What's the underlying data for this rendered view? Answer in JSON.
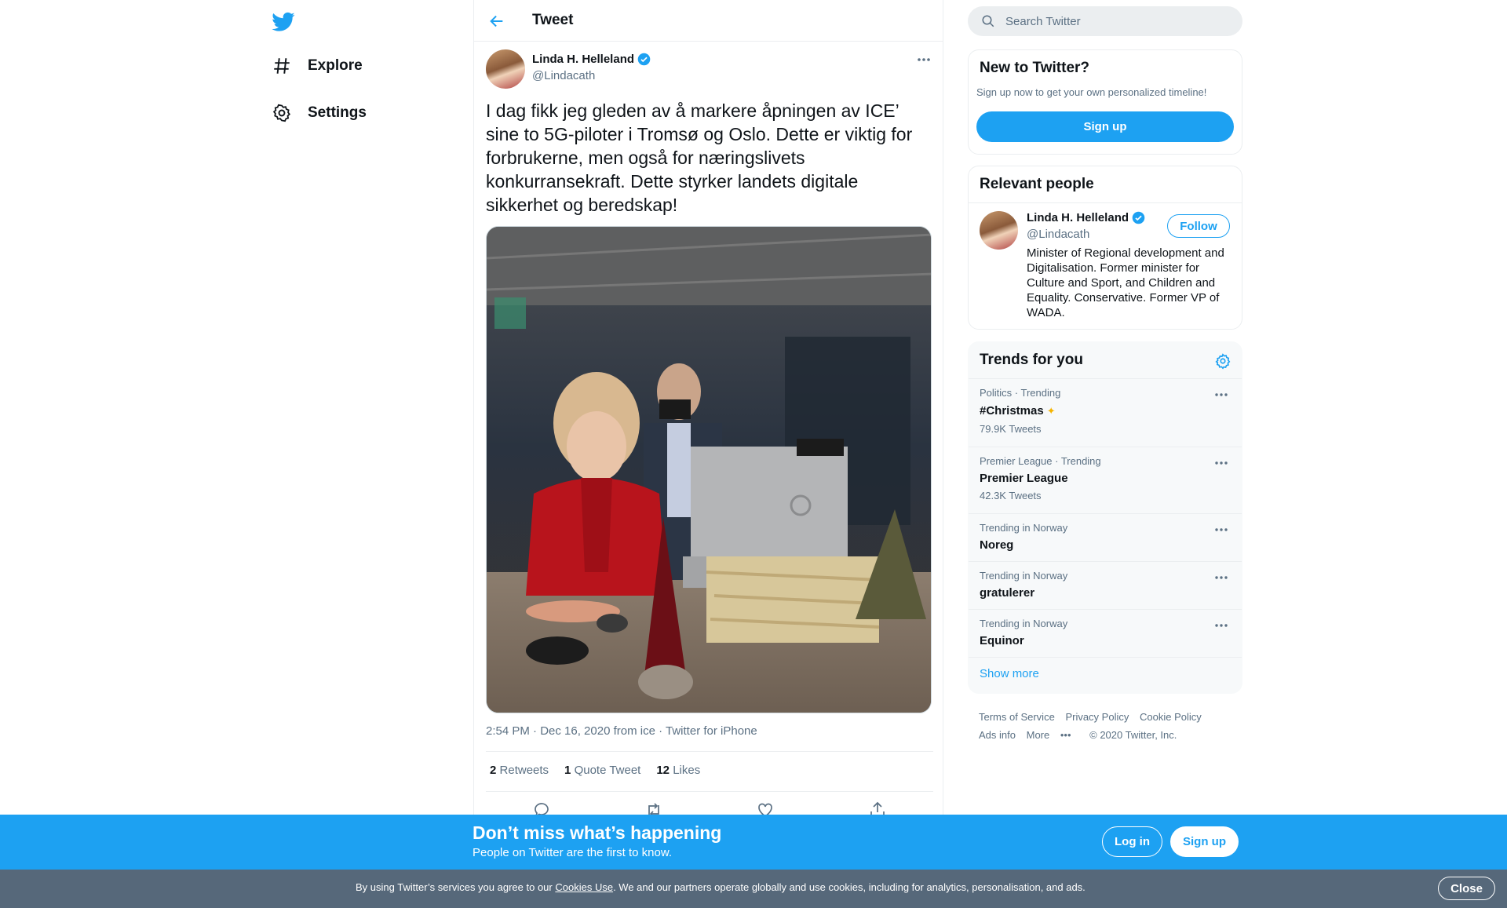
{
  "nav": {
    "logo_icon": "twitter-bird-icon",
    "items": [
      {
        "label": "Explore",
        "icon": "hashtag-icon"
      },
      {
        "label": "Settings",
        "icon": "gear-icon"
      }
    ]
  },
  "header": {
    "title": "Tweet",
    "back_icon": "arrow-left-icon"
  },
  "tweet": {
    "author_name": "Linda H. Helleland",
    "author_handle": "@Lindacath",
    "verified": true,
    "text": "I dag fikk jeg gleden av å markere åpningen av ICE’ sine to 5G-piloter i Tromsø og Oslo. Dette er viktig for forbrukerne, men også for næringslivets konkurransekraft. Dette styrker landets digitale sikkerhet og beredskap!",
    "time": "2:54 PM · Dec 16, 2020 from ice",
    "source": "Twitter for iPhone",
    "retweets_count": "2",
    "retweets_label": "Retweets",
    "quotes_count": "1",
    "quotes_label": "Quote Tweet",
    "likes_count": "12",
    "likes_label": "Likes"
  },
  "search": {
    "placeholder": "Search Twitter"
  },
  "new_to_twitter": {
    "title": "New to Twitter?",
    "subtitle": "Sign up now to get your own personalized timeline!",
    "button": "Sign up"
  },
  "relevant": {
    "title": "Relevant people",
    "name": "Linda H. Helleland",
    "handle": "@Lindacath",
    "follow": "Follow",
    "bio": "Minister of Regional development and Digitalisation. Former minister for Culture and Sport, and Children and Equality. Conservative. Former VP of WADA."
  },
  "trends": {
    "title": "Trends for you",
    "items": [
      {
        "context": "Politics · Trending",
        "name": "#Christmas",
        "count": "79.9K Tweets"
      },
      {
        "context": "Premier League · Trending",
        "name": "Premier League",
        "count": "42.3K Tweets"
      },
      {
        "context": "Trending in Norway",
        "name": "Noreg",
        "count": ""
      },
      {
        "context": "Trending in Norway",
        "name": "gratulerer",
        "count": ""
      },
      {
        "context": "Trending in Norway",
        "name": "Equinor",
        "count": ""
      }
    ],
    "show_more": "Show more"
  },
  "footer": {
    "links": [
      "Terms of Service",
      "Privacy Policy",
      "Cookie Policy",
      "Ads info",
      "More"
    ],
    "copyright": "© 2020 Twitter, Inc."
  },
  "banner": {
    "headline": "Don’t miss what’s happening",
    "subline": "People on Twitter are the first to know.",
    "login": "Log in",
    "signup": "Sign up"
  },
  "cookie": {
    "prefix": "By using Twitter’s services you agree to our ",
    "link": "Cookies Use",
    "suffix": ". We and our partners operate globally and use cookies, including for analytics, personalisation, and ads.",
    "close": "Close"
  },
  "colors": {
    "accent": "#1da1f2",
    "secondary_text": "#5b7083",
    "cookie_bar": "#56687a"
  }
}
